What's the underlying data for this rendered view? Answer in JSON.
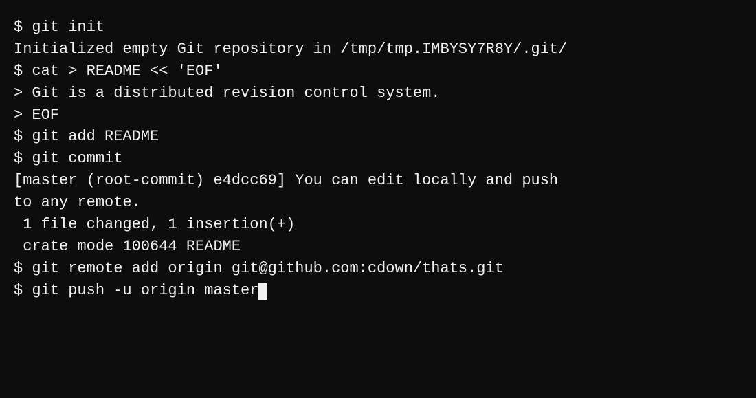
{
  "terminal": {
    "lines": [
      {
        "id": "line1",
        "text": "$ git init"
      },
      {
        "id": "line2",
        "text": "Initialized empty Git repository in /tmp/tmp.IMBYSY7R8Y/.git/"
      },
      {
        "id": "line3",
        "text": "$ cat > README << 'EOF'"
      },
      {
        "id": "line4",
        "text": "> Git is a distributed revision control system."
      },
      {
        "id": "line5",
        "text": "> EOF"
      },
      {
        "id": "line6",
        "text": "$ git add README"
      },
      {
        "id": "line7",
        "text": "$ git commit"
      },
      {
        "id": "line8",
        "text": "[master (root-commit) e4dcc69] You can edit locally and push"
      },
      {
        "id": "line9",
        "text": "to any remote."
      },
      {
        "id": "line10",
        "text": " 1 file changed, 1 insertion(+)"
      },
      {
        "id": "line11",
        "text": " crate mode 100644 README"
      },
      {
        "id": "line12",
        "text": "$ git remote add origin git@github.com:cdown/thats.git"
      },
      {
        "id": "line13",
        "text": "$ git push -u origin master",
        "hasCursor": true
      }
    ],
    "background": "#0d0d0d",
    "foreground": "#f0f0f0"
  }
}
